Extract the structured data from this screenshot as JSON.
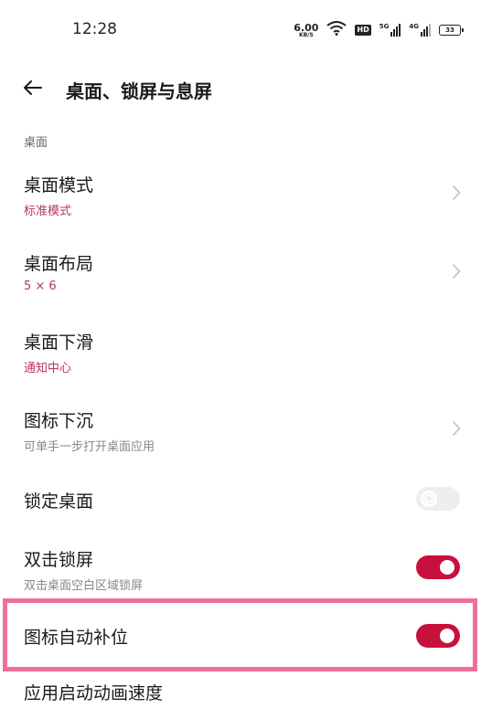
{
  "status_bar": {
    "time": "12:28",
    "net_speed_value": "6.00",
    "net_speed_unit": "KB/S",
    "hd_badge": "HD",
    "sim1_label": "5G",
    "sim2_label": "4G",
    "battery_level": "33"
  },
  "header": {
    "title": "桌面、锁屏与息屏"
  },
  "section": {
    "label": "桌面"
  },
  "rows": [
    {
      "title": "桌面模式",
      "subtitle": "标准模式",
      "control": "chevron"
    },
    {
      "title": "桌面布局",
      "subtitle": "5 × 6",
      "control": "chevron"
    },
    {
      "title": "桌面下滑",
      "subtitle": "通知中心",
      "control": "none"
    },
    {
      "title": "图标下沉",
      "subtitle": "可单手一步打开桌面应用",
      "control": "chevron"
    },
    {
      "title": "锁定桌面",
      "control": "toggle",
      "enabled": false
    },
    {
      "title": "双击锁屏",
      "subtitle": "双击桌面空白区域锁屏",
      "control": "toggle",
      "enabled": true
    },
    {
      "title": "图标自动补位",
      "control": "toggle",
      "enabled": true,
      "highlighted": true
    },
    {
      "title": "应用启动动画速度"
    }
  ],
  "colors": {
    "accent": "#c8103d",
    "subtitle_accent": "#b5375a",
    "highlight_border": "#ee6f9f",
    "toggle_off": "#eeeeee"
  }
}
